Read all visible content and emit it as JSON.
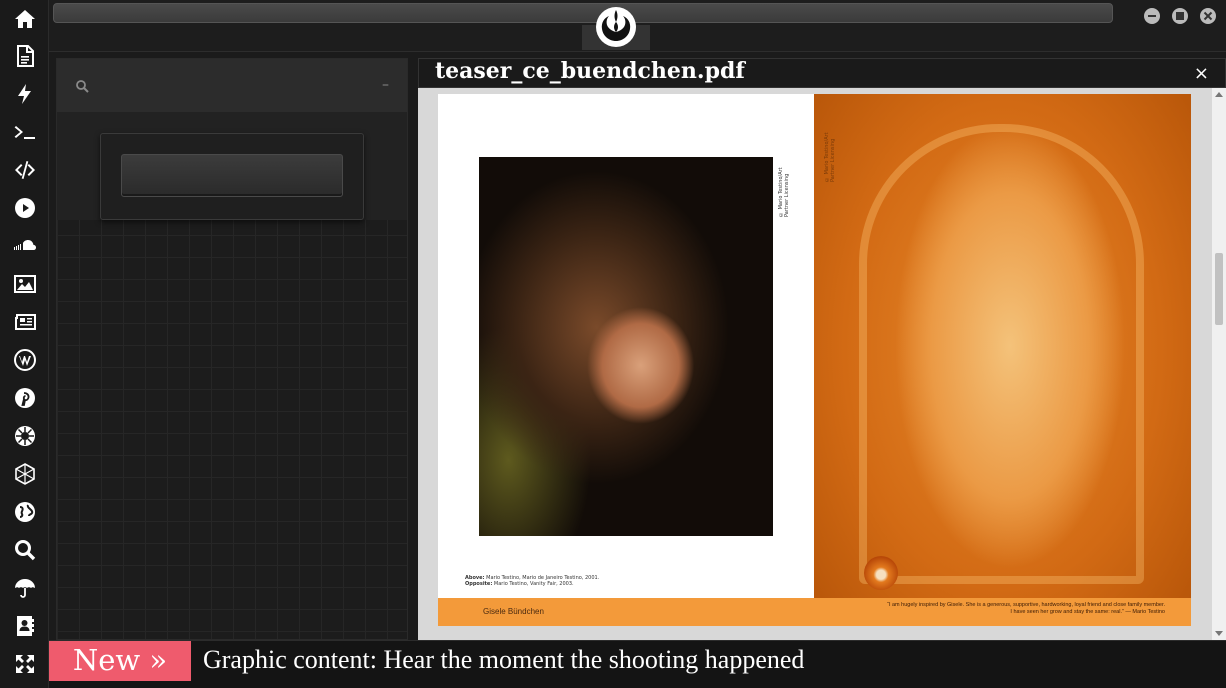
{
  "rail": {
    "icons": [
      "home-icon",
      "document-icon",
      "bolt-icon",
      "terminal-icon",
      "code-icon",
      "play-icon",
      "soundcloud-icon",
      "image-icon",
      "newspaper-icon",
      "wordpress-icon",
      "pinterest-icon",
      "galactic-empire-icon",
      "atom-icon",
      "globe-icon",
      "search-icon",
      "umbrella-icon",
      "contacts-icon",
      "expand-icon"
    ]
  },
  "topbar": {
    "logo_icon": "rebel-alliance-icon",
    "window_buttons": [
      "minimize-icon",
      "maximize-icon",
      "close-icon"
    ]
  },
  "panel": {
    "search_icon": "search-icon",
    "collapse_label": "–"
  },
  "viewer": {
    "title": "teaser_ce_buendchen.pdf",
    "close_label": "×",
    "page": {
      "left_caption_line1_bold": "Above:",
      "left_caption_line1": "Mario Testino, Mario de Janeiro Testino, 2001.",
      "left_caption_line2_bold": "Opposite:",
      "left_caption_line2": "Mario Testino, Vanity Fair, 2003.",
      "photo_credit_vertical": "© Mario Testino/Art Partner Licensing",
      "footer_name": "Gisele Bündchen",
      "footer_quote": "“I am hugely inspired by Gisele. She is a generous, supportive, hardworking, loyal friend and close family member. I have seen her grow and stay the same: real.” — Mario Testino"
    }
  },
  "ticker": {
    "badge": "New »",
    "headline": "Graphic content: Hear the moment the shooting happened"
  },
  "colors": {
    "accent_badge": "#ef5b6d",
    "footer_band": "#f39a3a"
  }
}
